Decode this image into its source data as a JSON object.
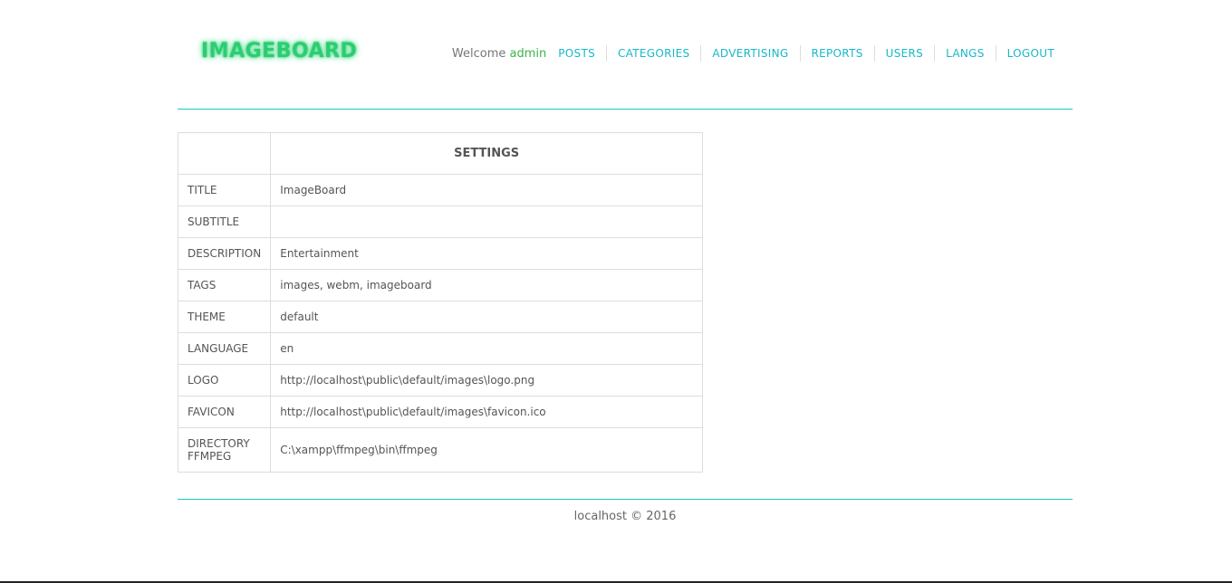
{
  "header": {
    "logo": "IMAGEBOARD",
    "welcome_text": "Welcome",
    "username": "admin",
    "nav": [
      "POSTS",
      "CATEGORIES",
      "ADVERTISING",
      "REPORTS",
      "USERS",
      "LANGS",
      "LOGOUT"
    ]
  },
  "settings": {
    "heading": "SETTINGS",
    "rows": [
      {
        "key": "TITLE",
        "value": "ImageBoard"
      },
      {
        "key": "SUBTITLE",
        "value": ""
      },
      {
        "key": "DESCRIPTION",
        "value": "Entertainment"
      },
      {
        "key": "TAGS",
        "value": "images, webm, imageboard"
      },
      {
        "key": "THEME",
        "value": "default"
      },
      {
        "key": "LANGUAGE",
        "value": "en"
      },
      {
        "key": "LOGO",
        "value": "http://localhost\\public\\default/images\\logo.png"
      },
      {
        "key": "FAVICON",
        "value": "http://localhost\\public\\default/images\\favicon.ico"
      },
      {
        "key": "DIRECTORY FFMPEG",
        "value": "C:\\xampp\\ffmpeg\\bin\\ffmpeg"
      }
    ]
  },
  "footer": {
    "text": "localhost © 2016"
  },
  "colors": {
    "accent": "#17c7c7",
    "nav_link": "#18b8c8",
    "username": "#3bb34a",
    "logo": "#2ecc71"
  }
}
